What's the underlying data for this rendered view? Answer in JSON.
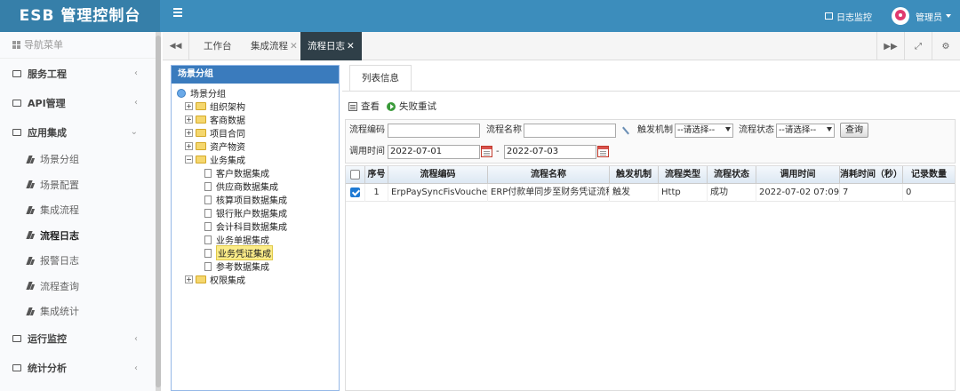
{
  "app": {
    "title": "ESB 管理控制台"
  },
  "header": {
    "monitor_label": "日志监控",
    "user_name": "管理员"
  },
  "sidebar": {
    "heading": "导航菜单",
    "groups": [
      {
        "label": "服务工程",
        "expanded": false
      },
      {
        "label": "API管理",
        "expanded": false
      },
      {
        "label": "应用集成",
        "expanded": true
      },
      {
        "label": "运行监控",
        "expanded": false
      },
      {
        "label": "统计分析",
        "expanded": false
      }
    ],
    "sub_items": [
      {
        "label": "场景分组",
        "active": false
      },
      {
        "label": "场景配置",
        "active": false
      },
      {
        "label": "集成流程",
        "active": false
      },
      {
        "label": "流程日志",
        "active": true
      },
      {
        "label": "报警日志",
        "active": false
      },
      {
        "label": "流程查询",
        "active": false
      },
      {
        "label": "集成统计",
        "active": false
      }
    ]
  },
  "tabs": [
    {
      "label": "工作台",
      "closable": false,
      "active": false
    },
    {
      "label": "集成流程",
      "closable": true,
      "active": false
    },
    {
      "label": "流程日志",
      "closable": true,
      "active": true
    }
  ],
  "tree_panel": {
    "title": "场景分组",
    "root": "场景分组",
    "nodes": [
      {
        "label": "组织架构",
        "type": "folder",
        "expanded": false
      },
      {
        "label": "客商数据",
        "type": "folder",
        "expanded": false
      },
      {
        "label": "项目合同",
        "type": "folder",
        "expanded": false
      },
      {
        "label": "资产物资",
        "type": "folder",
        "expanded": false
      },
      {
        "label": "业务集成",
        "type": "folder",
        "expanded": true
      },
      {
        "label": "客户数据集成",
        "type": "leaf"
      },
      {
        "label": "供应商数据集成",
        "type": "leaf"
      },
      {
        "label": "核算项目数据集成",
        "type": "leaf"
      },
      {
        "label": "银行账户数据集成",
        "type": "leaf"
      },
      {
        "label": "会计科目数据集成",
        "type": "leaf"
      },
      {
        "label": "业务单据集成",
        "type": "leaf"
      },
      {
        "label": "业务凭证集成",
        "type": "leaf",
        "selected": true
      },
      {
        "label": "参考数据集成",
        "type": "leaf"
      },
      {
        "label": "权限集成",
        "type": "folder",
        "expanded": false
      }
    ]
  },
  "list": {
    "tab_label": "列表信息",
    "toolbar": {
      "view_label": "查看",
      "retry_label": "失败重试"
    },
    "filters": {
      "code_label": "流程编码",
      "code_value": "",
      "name_label": "流程名称",
      "name_value": "",
      "trigger_label": "触发机制",
      "trigger_value": "--请选择--",
      "status_label": "流程状态",
      "status_value": "--请选择--",
      "query_button": "查询",
      "time_label": "调用时间",
      "date_from": "2022-07-01",
      "date_sep": "-",
      "date_to": "2022-07-03"
    },
    "columns": [
      "序号",
      "流程编码",
      "流程名称",
      "触发机制",
      "流程类型",
      "流程状态",
      "调用时间",
      "消耗时间（秒）",
      "记录数量"
    ],
    "rows": [
      {
        "checked": true,
        "no": "1",
        "code": "ErpPaySyncFisVoucher",
        "name": "ERP付款单同步至财务凭证流程",
        "trigger": "触发",
        "type": "Http",
        "status": "成功",
        "time": "2022-07-02 07:09",
        "cost": "7",
        "count": "0"
      }
    ]
  }
}
